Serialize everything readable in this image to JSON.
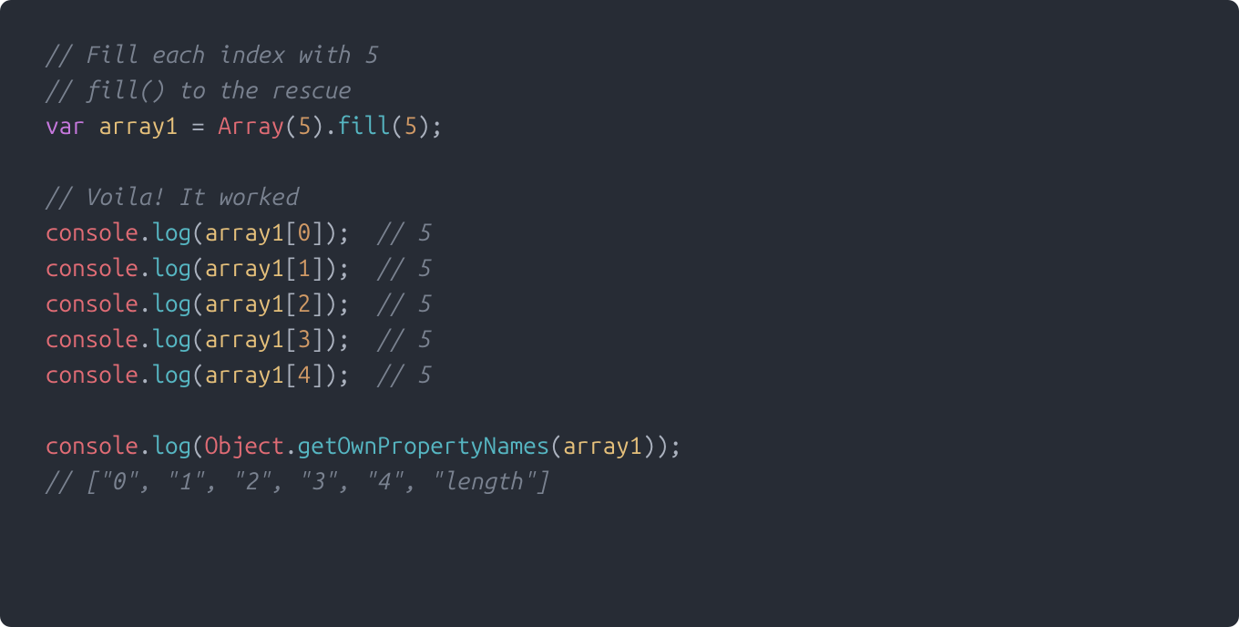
{
  "code": {
    "line1_comment": "// Fill each index with 5",
    "line2_comment": "// fill() to the rescue",
    "line3": {
      "keyword": "var",
      "varname": "array1",
      "equals": " = ",
      "class": "Array",
      "open1": "(",
      "arg1": "5",
      "close1": ")",
      "dot1": ".",
      "method": "fill",
      "open2": "(",
      "arg2": "5",
      "close2": ")",
      "semi": ";"
    },
    "line5_comment": "// Voila! It worked",
    "logline": {
      "obj": "console",
      "dot": ".",
      "method": "log",
      "open": "(",
      "arr": "array1",
      "bopen": "[",
      "bclose": "]",
      "close": ")",
      "semi": ";",
      "sp": "  ",
      "c": "// 5"
    },
    "indices": [
      "0",
      "1",
      "2",
      "3",
      "4"
    ],
    "line12": {
      "obj": "console",
      "dot": ".",
      "method": "log",
      "open": "(",
      "class": "Object",
      "dot2": ".",
      "method2": "getOwnPropertyNames",
      "open2": "(",
      "arg": "array1",
      "close2": ")",
      "close": ")",
      "semi": ";"
    },
    "line13_comment": "// [\"0\", \"1\", \"2\", \"3\", \"4\", \"length\"]"
  }
}
